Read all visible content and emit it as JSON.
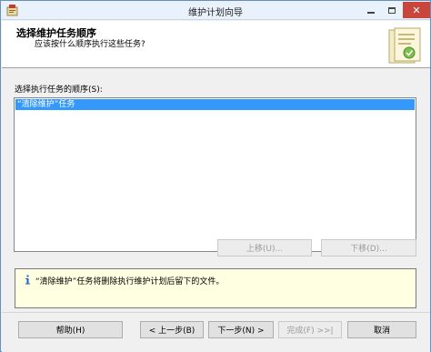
{
  "window": {
    "title": "维护计划向导"
  },
  "header": {
    "title": "选择维护任务顺序",
    "subtitle": "应该按什么顺序执行这些任务?"
  },
  "list": {
    "label": "选择执行任务的顺序(S):",
    "items": [
      "“清除维护”任务"
    ]
  },
  "order_buttons": {
    "move_up": "上移(U)...",
    "move_down": "下移(D)..."
  },
  "info": {
    "text": "“清除维护”任务将删除执行维护计划后留下的文件。"
  },
  "footer": {
    "help": "帮助(H)",
    "back": "< 上一步(B)",
    "next": "下一步(N) >",
    "finish": "完成(F) >>|",
    "cancel": "取消"
  },
  "icons": {
    "app": "app-icon",
    "info": "info-icon",
    "header": "wizard-graphic-icon"
  }
}
